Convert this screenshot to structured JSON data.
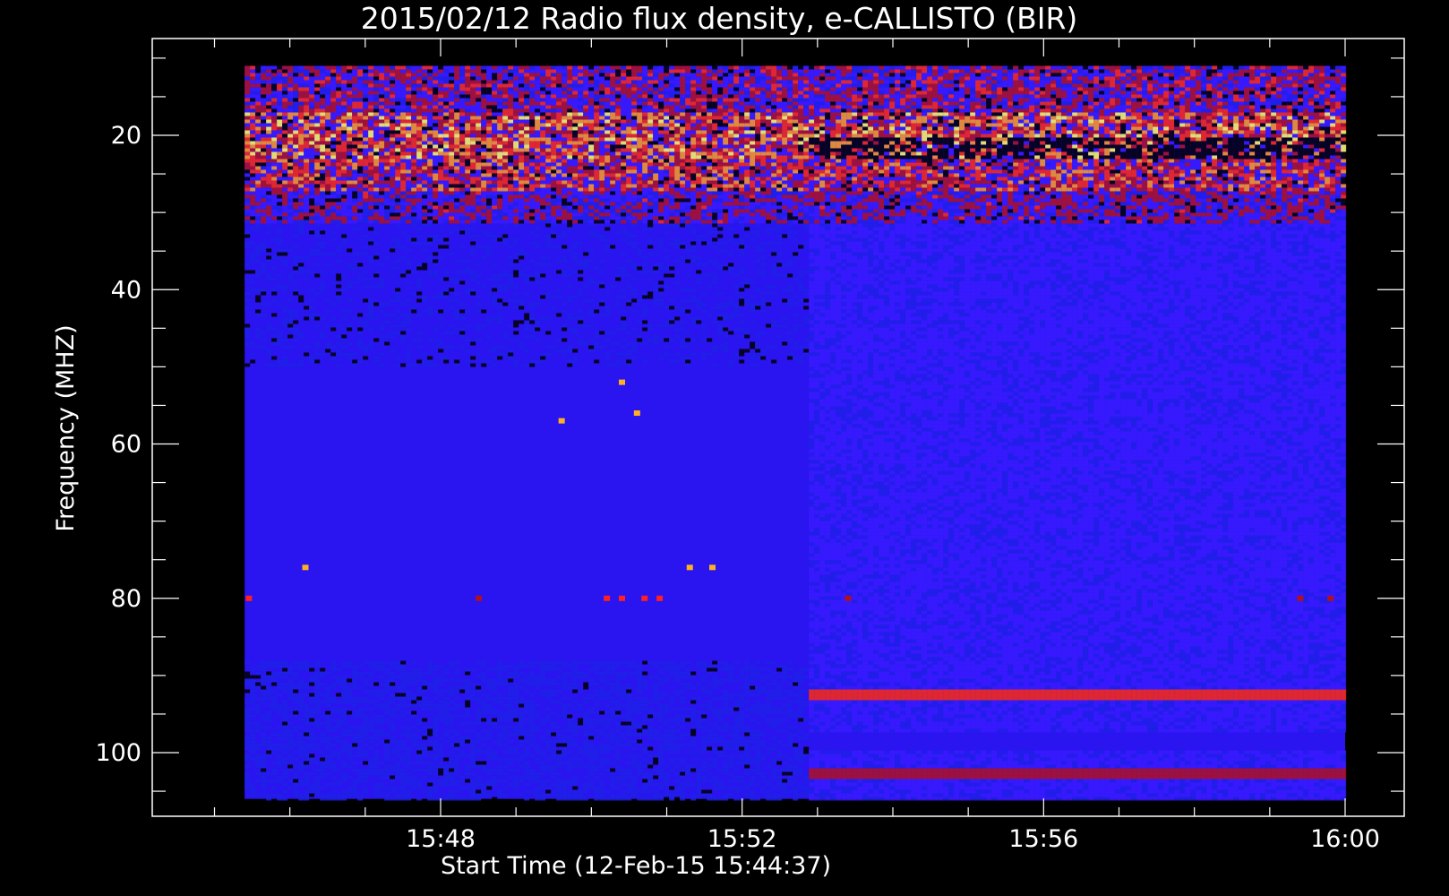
{
  "chart_data": {
    "type": "heatmap",
    "title": "2015/02/12  Radio flux density, e-CALLISTO (BIR)",
    "xlabel": "Start Time (12-Feb-15 15:44:37)",
    "ylabel": "Frequency (MHZ)",
    "xlim": [
      "15:44:37",
      "16:00:00"
    ],
    "ylim": [
      10,
      106
    ],
    "y_inverted": true,
    "x_ticks": [
      "15:48",
      "15:52",
      "15:56",
      "16:00"
    ],
    "x_tick_minutes": [
      48,
      52,
      56,
      60
    ],
    "y_ticks": [
      "20",
      "40",
      "60",
      "80",
      "100"
    ],
    "y_tick_values": [
      20,
      40,
      60,
      80,
      100
    ],
    "data_extent": {
      "t_start_min": 45.4,
      "t_end_min": 60.0,
      "f_min": 11,
      "f_max": 106
    },
    "instrument_change_min": 52.85,
    "colormap": [
      "#000000",
      "#2020e8",
      "#3a1aff",
      "#b01020",
      "#ff2a10",
      "#ff9c20",
      "#ffff60"
    ],
    "bands": [
      {
        "f0": 11,
        "f1": 17,
        "intensity": 0.55
      },
      {
        "f0": 17,
        "f1": 23,
        "intensity": 0.8
      },
      {
        "f0": 23,
        "f1": 27,
        "intensity": 0.7
      },
      {
        "f0": 27,
        "f1": 31,
        "intensity": 0.5
      },
      {
        "f0": 31,
        "f1": 50,
        "intensity": 0.15
      },
      {
        "f0": 50,
        "f1": 88,
        "intensity": 0.1
      },
      {
        "f0": 88,
        "f1": 106,
        "intensity": 0.2
      }
    ],
    "spots": [
      {
        "t": 45.45,
        "f": 80,
        "c": "#ff2020"
      },
      {
        "t": 46.2,
        "f": 76,
        "c": "#ffb020"
      },
      {
        "t": 48.5,
        "f": 80,
        "c": "#b01020"
      },
      {
        "t": 50.2,
        "f": 80,
        "c": "#ff2020"
      },
      {
        "t": 50.4,
        "f": 80,
        "c": "#ff2020"
      },
      {
        "t": 50.7,
        "f": 80,
        "c": "#ff2020"
      },
      {
        "t": 50.9,
        "f": 80,
        "c": "#ff2020"
      },
      {
        "t": 51.3,
        "f": 76,
        "c": "#ffb020"
      },
      {
        "t": 51.6,
        "f": 76,
        "c": "#ffb020"
      },
      {
        "t": 50.4,
        "f": 52,
        "c": "#ffb020"
      },
      {
        "t": 50.6,
        "f": 56,
        "c": "#ffb020"
      },
      {
        "t": 49.6,
        "f": 57,
        "c": "#ffb020"
      },
      {
        "t": 53.4,
        "f": 80,
        "c": "#b01020"
      },
      {
        "t": 59.4,
        "f": 80,
        "c": "#b01020"
      },
      {
        "t": 59.8,
        "f": 80,
        "c": "#b01020"
      }
    ]
  }
}
